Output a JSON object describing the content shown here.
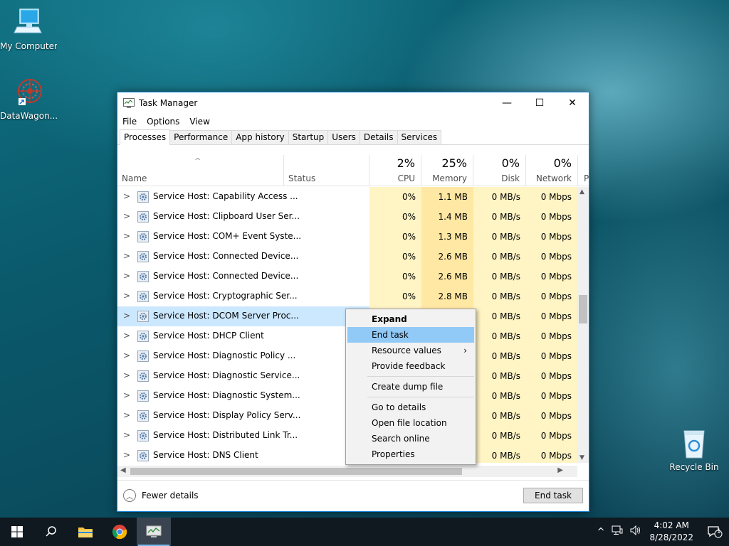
{
  "desktop": {
    "icons": [
      {
        "label": "My Computer"
      },
      {
        "label": "DataWagon..."
      },
      {
        "label": "Recycle Bin"
      }
    ]
  },
  "window": {
    "title": "Task Manager",
    "minimize": "—",
    "maximize": "☐",
    "close": "✕"
  },
  "menu": [
    "File",
    "Options",
    "View"
  ],
  "tabs": [
    "Processes",
    "Performance",
    "App history",
    "Startup",
    "Users",
    "Details",
    "Services"
  ],
  "columns": {
    "name": "Name",
    "status": "Status",
    "cpu": {
      "pct": "2%",
      "label": "CPU"
    },
    "memory": {
      "pct": "25%",
      "label": "Memory"
    },
    "disk": {
      "pct": "0%",
      "label": "Disk"
    },
    "network": {
      "pct": "0%",
      "label": "Network"
    },
    "power_partial": "P"
  },
  "rows": [
    {
      "name": "Service Host: Capability Access ...",
      "cpu": "0%",
      "mem": "1.1 MB",
      "disk": "0 MB/s",
      "net": "0 Mbps"
    },
    {
      "name": "Service Host: Clipboard User Ser...",
      "cpu": "0%",
      "mem": "1.4 MB",
      "disk": "0 MB/s",
      "net": "0 Mbps"
    },
    {
      "name": "Service Host: COM+ Event Syste...",
      "cpu": "0%",
      "mem": "1.3 MB",
      "disk": "0 MB/s",
      "net": "0 Mbps"
    },
    {
      "name": "Service Host: Connected Device...",
      "cpu": "0%",
      "mem": "2.6 MB",
      "disk": "0 MB/s",
      "net": "0 Mbps"
    },
    {
      "name": "Service Host: Connected Device...",
      "cpu": "0%",
      "mem": "2.6 MB",
      "disk": "0 MB/s",
      "net": "0 Mbps"
    },
    {
      "name": "Service Host: Cryptographic Ser...",
      "cpu": "0%",
      "mem": "2.8 MB",
      "disk": "0 MB/s",
      "net": "0 Mbps"
    },
    {
      "name": "Service Host: DCOM Server Proc...",
      "cpu": "",
      "mem": "",
      "disk": "0 MB/s",
      "net": "0 Mbps"
    },
    {
      "name": "Service Host: DHCP Client",
      "cpu": "",
      "mem": "",
      "disk": "0 MB/s",
      "net": "0 Mbps"
    },
    {
      "name": "Service Host: Diagnostic Policy ...",
      "cpu": "",
      "mem": "",
      "disk": "0 MB/s",
      "net": "0 Mbps"
    },
    {
      "name": "Service Host: Diagnostic Service...",
      "cpu": "",
      "mem": "",
      "disk": "0 MB/s",
      "net": "0 Mbps"
    },
    {
      "name": "Service Host: Diagnostic System...",
      "cpu": "",
      "mem": "",
      "disk": "0 MB/s",
      "net": "0 Mbps"
    },
    {
      "name": "Service Host: Display Policy Serv...",
      "cpu": "",
      "mem": "",
      "disk": "0 MB/s",
      "net": "0 Mbps"
    },
    {
      "name": "Service Host: Distributed Link Tr...",
      "cpu": "",
      "mem": "",
      "disk": "0 MB/s",
      "net": "0 Mbps"
    },
    {
      "name": "Service Host: DNS Client",
      "cpu": "",
      "mem": "",
      "disk": "0 MB/s",
      "net": "0 Mbps"
    }
  ],
  "selected_row": 6,
  "context_menu": {
    "items": [
      {
        "label": "Expand",
        "bold": true
      },
      {
        "label": "End task",
        "hover": true
      },
      {
        "label": "Resource values",
        "submenu": "›"
      },
      {
        "label": "Provide feedback"
      },
      {
        "sep": true
      },
      {
        "label": "Create dump file"
      },
      {
        "sep": true
      },
      {
        "label": "Go to details"
      },
      {
        "label": "Open file location"
      },
      {
        "label": "Search online"
      },
      {
        "label": "Properties"
      }
    ]
  },
  "footer": {
    "fewer_details": "Fewer details",
    "end_task": "End task"
  },
  "taskbar": {
    "time": "4:02 AM",
    "date": "8/28/2022",
    "notification_count": "1"
  },
  "icons": {
    "gear": "gear-icon",
    "chevron": "chevron-right-icon"
  },
  "colors": {
    "accent": "#1883d7",
    "selected_row": "#cce8ff",
    "menu_hover": "#91c9f7",
    "cell_light": "#fff4c4",
    "cell_memory": "#ffe8a3"
  }
}
